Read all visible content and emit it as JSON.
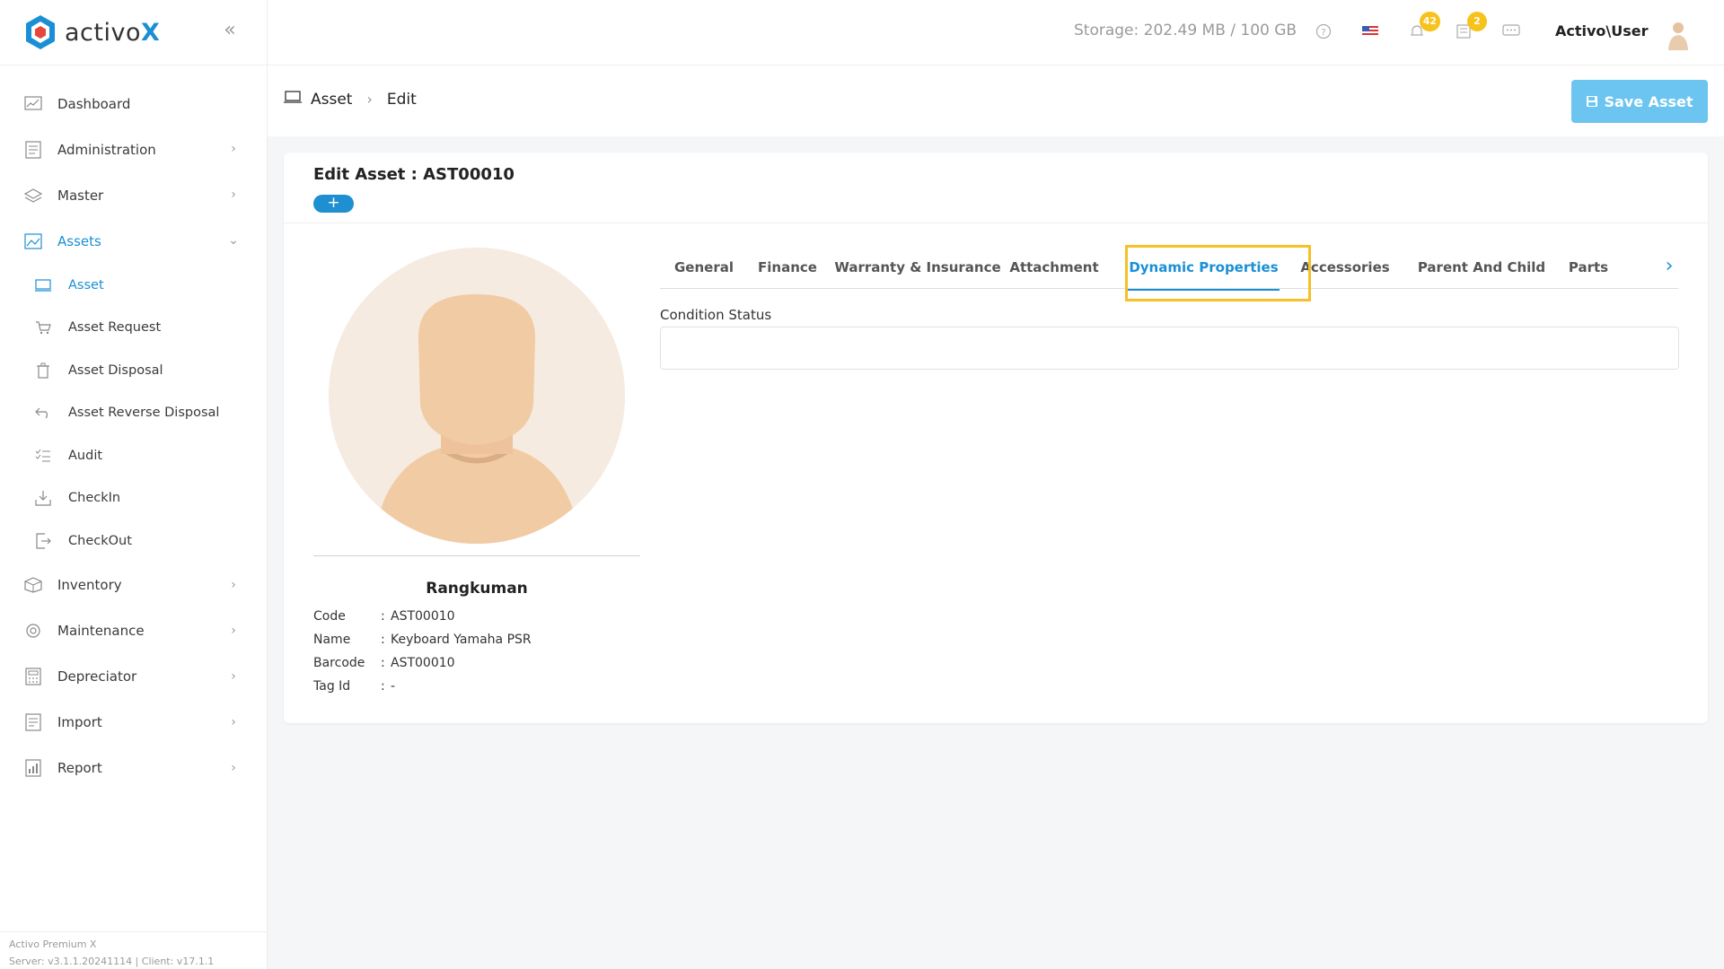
{
  "brand": {
    "logo_text_main": "activo",
    "logo_text_accent": "X"
  },
  "sidebar": {
    "items": [
      {
        "label": "Dashboard",
        "icon": "chart-icon"
      },
      {
        "label": "Administration",
        "icon": "clipboard-icon"
      },
      {
        "label": "Master",
        "icon": "layers-icon"
      },
      {
        "label": "Assets",
        "icon": "image-icon"
      },
      {
        "label": "Inventory",
        "icon": "box-icon"
      },
      {
        "label": "Maintenance",
        "icon": "gear-icon"
      },
      {
        "label": "Depreciator",
        "icon": "calculator-icon"
      },
      {
        "label": "Import",
        "icon": "import-icon"
      },
      {
        "label": "Report",
        "icon": "report-icon"
      }
    ],
    "asset_sub": [
      {
        "label": "Asset",
        "icon": "monitor-icon"
      },
      {
        "label": "Asset Request",
        "icon": "cart-icon"
      },
      {
        "label": "Asset Disposal",
        "icon": "trash-icon"
      },
      {
        "label": "Asset Reverse Disposal",
        "icon": "undo-icon"
      },
      {
        "label": "Audit",
        "icon": "checklist-icon"
      },
      {
        "label": "CheckIn",
        "icon": "download-icon"
      },
      {
        "label": "CheckOut",
        "icon": "logout-icon"
      }
    ],
    "footer_line1": "Activo Premium X",
    "footer_line2": "Server: v3.1.1.20241114 | Client: v17.1.1"
  },
  "topbar": {
    "storage": "Storage: 202.49 MB / 100 GB",
    "notification_count": "42",
    "task_count": "2",
    "user": "Activo\\User"
  },
  "breadcrumb": {
    "root": "Asset",
    "current": "Edit"
  },
  "save_button": "Save Asset",
  "card": {
    "title": "Edit Asset : AST00010",
    "plus": "+"
  },
  "asset": {
    "heading": "Rangkuman",
    "rows": [
      {
        "key": "Code",
        "value": "AST00010"
      },
      {
        "key": "Name",
        "value": "Keyboard Yamaha PSR"
      },
      {
        "key": "Barcode",
        "value": "AST00010"
      },
      {
        "key": "Tag Id",
        "value": "-"
      }
    ]
  },
  "tabs": [
    {
      "label": "General"
    },
    {
      "label": "Finance"
    },
    {
      "label": "Warranty & Insurance"
    },
    {
      "label": "Attachment"
    },
    {
      "label": "Dynamic Properties",
      "active": true
    },
    {
      "label": "Accessories"
    },
    {
      "label": "Parent And Child"
    },
    {
      "label": "Parts"
    }
  ],
  "field": {
    "label": "Condition Status",
    "value": ""
  },
  "colors": {
    "accent": "#1a8fd6",
    "highlight": "#f5c127",
    "badge": "#f7c21b",
    "save": "#6cc5f0"
  }
}
